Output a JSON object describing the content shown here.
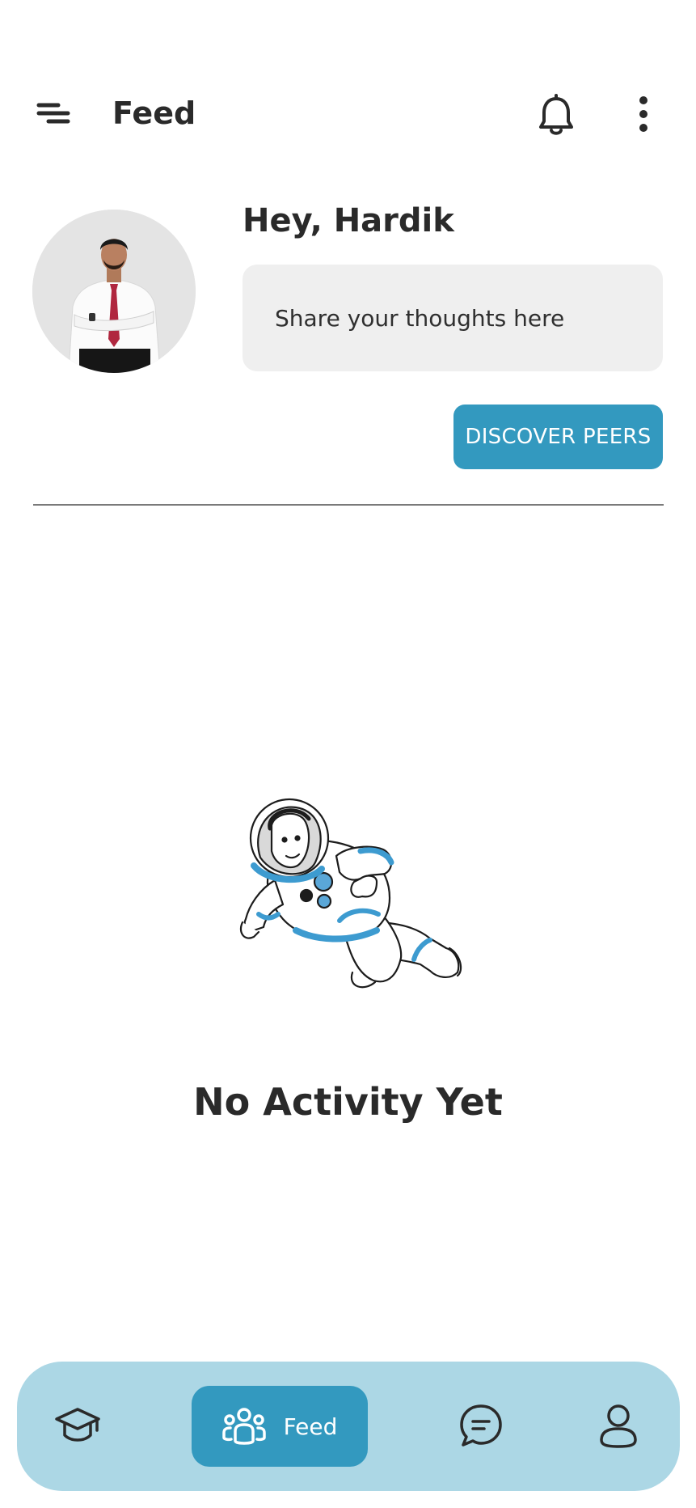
{
  "header": {
    "title": "Feed",
    "menu_icon": "menu-icon",
    "notification_icon": "bell-icon",
    "more_icon": "more-vertical-icon"
  },
  "profile": {
    "greeting": "Hey, Hardik",
    "avatar_description": "avatar"
  },
  "composer": {
    "placeholder": "Share your thoughts here"
  },
  "actions": {
    "discover_label": "DISCOVER PEERS"
  },
  "empty_state": {
    "illustration": "astronaut-illustration",
    "message": "No Activity Yet"
  },
  "bottom_nav": {
    "items": [
      {
        "icon": "graduation-cap-icon",
        "label": "",
        "active": false
      },
      {
        "icon": "people-icon",
        "label": "Feed",
        "active": true
      },
      {
        "icon": "chat-bubble-icon",
        "label": "",
        "active": false
      },
      {
        "icon": "user-icon",
        "label": "",
        "active": false
      }
    ]
  },
  "colors": {
    "accent": "#3399bf",
    "nav_background": "#acd7e5",
    "input_background": "#efefef",
    "text": "#2a2a2a"
  }
}
